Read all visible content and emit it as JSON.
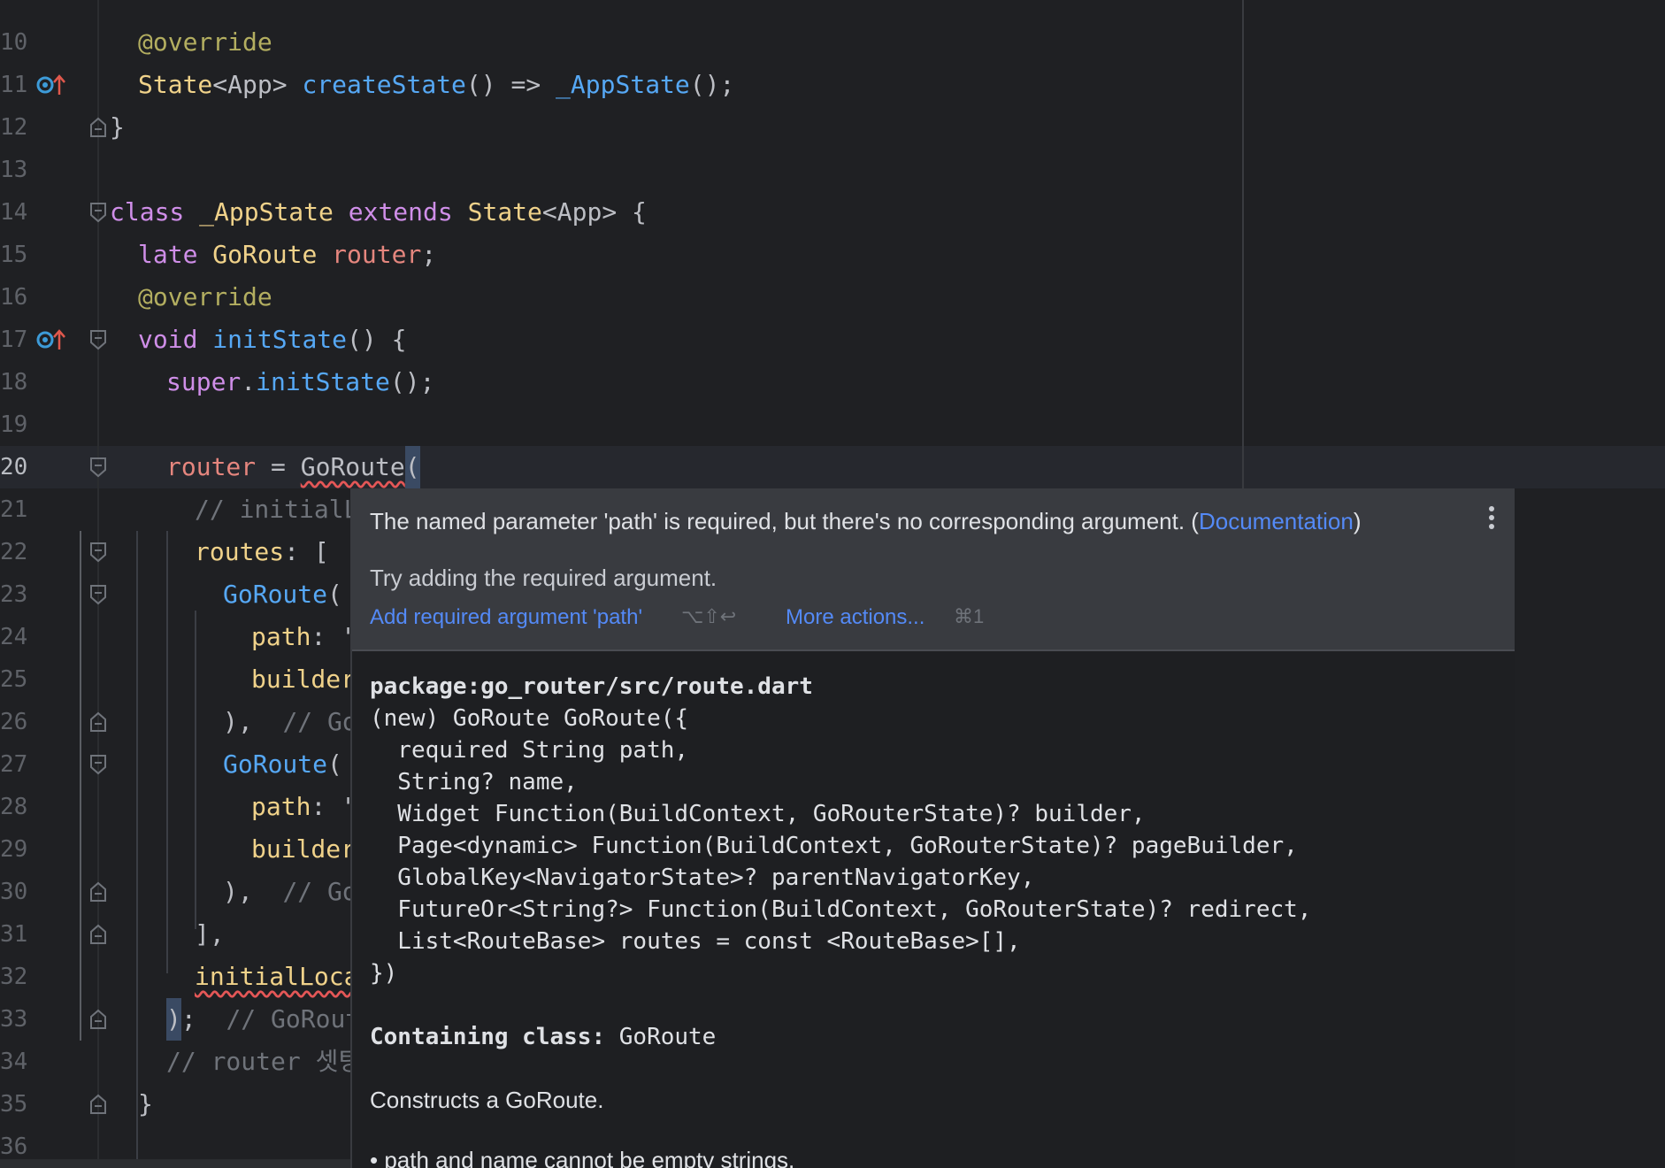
{
  "editor": {
    "line_numbers": [
      "10",
      "11",
      "12",
      "13",
      "14",
      "15",
      "16",
      "17",
      "18",
      "19",
      "20",
      "21",
      "22",
      "23",
      "24",
      "25",
      "26",
      "27",
      "28",
      "29",
      "30",
      "31",
      "32",
      "33",
      "34",
      "35",
      "36"
    ],
    "active_line": "20",
    "gutter_icons": {
      "line11": "override-method-icon",
      "line17": "override-method-icon"
    },
    "code": {
      "l10_annotation": "@override",
      "l11_type": "State",
      "l11_generic": "<App>",
      "l11_fn": "createState",
      "l11_mid": "() => ",
      "l11_fn2": "_AppState",
      "l11_end": "();",
      "l12_text": "}",
      "l14_kw": "class",
      "l14_cls": "_AppState",
      "l14_kw2": "extends",
      "l14_sup": "State",
      "l14_rest": "<App> {",
      "l15_kw": "late",
      "l15_type": "GoRoute",
      "l15_var": "router",
      "l15_end": ";",
      "l16_annotation": "@override",
      "l17_kw": "void",
      "l17_fn": "initState",
      "l17_end": "() {",
      "l18_kw": "super",
      "l18_dot": ".",
      "l18_fn": "initState",
      "l18_end": "();",
      "l20_var": "router",
      "l20_eq": " = ",
      "l20_fn": "GoRoute",
      "l20_paren": "(",
      "l21_comment": "// initialL",
      "l22_prop": "routes",
      "l22_rest": ": [",
      "l23_fn": "GoRoute",
      "l23_paren": "(",
      "l24_prop": "path",
      "l24_rest": ": '",
      "l25_prop": "builder",
      "l26_text": "),",
      "l26_comment": "// Go",
      "l27_fn": "GoRoute",
      "l27_paren": "(",
      "l28_prop": "path",
      "l28_rest": ": '",
      "l29_prop": "builder",
      "l30_text": "),",
      "l30_comment": "// Go",
      "l31_text": "],",
      "l32_prop": "initialLoca",
      "l33_paren": ")",
      "l33_semi": ";",
      "l33_comment": "// GoRout",
      "l34_comment": "// router 셋팅",
      "l35_text": "}"
    }
  },
  "popup": {
    "message_prefix": "The named parameter 'path' is required, but there's no corresponding argument. (",
    "message_link": "Documentation",
    "message_suffix": ")",
    "hint": "Try adding the required argument.",
    "action_primary": "Add required argument 'path'",
    "action_primary_shortcut": "⌥⇧↩",
    "action_more": "More actions...",
    "action_more_shortcut": "⌘1",
    "menu_icon": "more-vertical-icon",
    "doc": {
      "package": "package:go_router/src/route.dart",
      "signature": [
        "(new) GoRoute GoRoute({",
        "  required String path,",
        "  String? name,",
        "  Widget Function(BuildContext, GoRouterState)? builder,",
        "  Page<dynamic> Function(BuildContext, GoRouterState)? pageBuilder,",
        "  GlobalKey<NavigatorState>? parentNavigatorKey,",
        "  FutureOr<String?> Function(BuildContext, GoRouterState)? redirect,",
        "  List<RouteBase> routes = const <RouteBase>[],",
        "})"
      ],
      "containing_label": "Containing class:",
      "containing_value": "GoRoute",
      "description": "Constructs a GoRoute.",
      "bullet": "• path and name cannot be empty strings."
    }
  }
}
